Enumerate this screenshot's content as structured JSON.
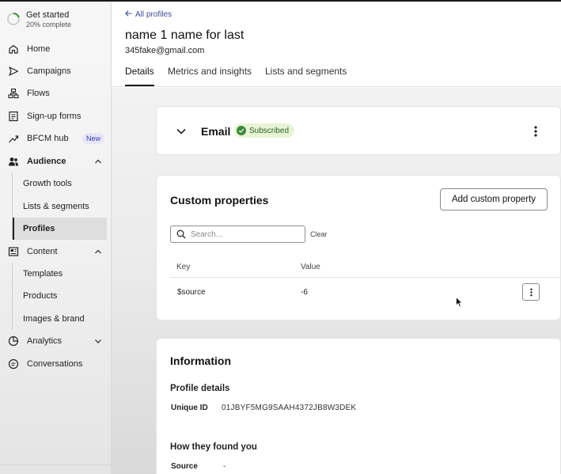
{
  "sidebar": {
    "get_started": {
      "title": "Get started",
      "progress_text": "20% complete",
      "progress": 0.2
    },
    "items": [
      {
        "label": "Home",
        "icon": "home-icon"
      },
      {
        "label": "Campaigns",
        "icon": "send-icon"
      },
      {
        "label": "Flows",
        "icon": "flow-icon"
      },
      {
        "label": "Sign-up forms",
        "icon": "form-icon"
      },
      {
        "label": "BFCM hub",
        "icon": "trend-icon",
        "badge": "New"
      },
      {
        "label": "Audience",
        "icon": "people-icon",
        "expanded": true
      },
      {
        "label": "Content",
        "icon": "content-icon",
        "expanded": true
      },
      {
        "label": "Analytics",
        "icon": "analytics-icon",
        "expanded": false
      },
      {
        "label": "Conversations",
        "icon": "chat-icon"
      }
    ],
    "audience_sub": [
      {
        "label": "Growth tools"
      },
      {
        "label": "Lists & segments"
      },
      {
        "label": "Profiles",
        "active": true
      }
    ],
    "content_sub": [
      {
        "label": "Templates"
      },
      {
        "label": "Products"
      },
      {
        "label": "Images & brand"
      }
    ]
  },
  "header": {
    "back_link": "All profiles",
    "profile_name": "name 1 name for last",
    "email": "345fake@gmail.com",
    "tabs": [
      {
        "label": "Details",
        "active": true
      },
      {
        "label": "Metrics and insights"
      },
      {
        "label": "Lists and segments"
      }
    ]
  },
  "email_card": {
    "title": "Email",
    "status": "Subscribed",
    "status_color": "#3d8a3a"
  },
  "custom_properties": {
    "title": "Custom properties",
    "add_button": "Add custom property",
    "search_placeholder": "Search...",
    "clear_label": "Clear",
    "columns": [
      "Key",
      "Value"
    ],
    "rows": [
      {
        "key": "$source",
        "value": "-6"
      }
    ]
  },
  "information": {
    "title": "Information",
    "profile_details_heading": "Profile details",
    "unique_id_label": "Unique ID",
    "unique_id": "01JBYF5MG9SAAH4372JB8W3DEK",
    "found_heading": "How they found you",
    "source_label": "Source",
    "source_value": "-"
  }
}
